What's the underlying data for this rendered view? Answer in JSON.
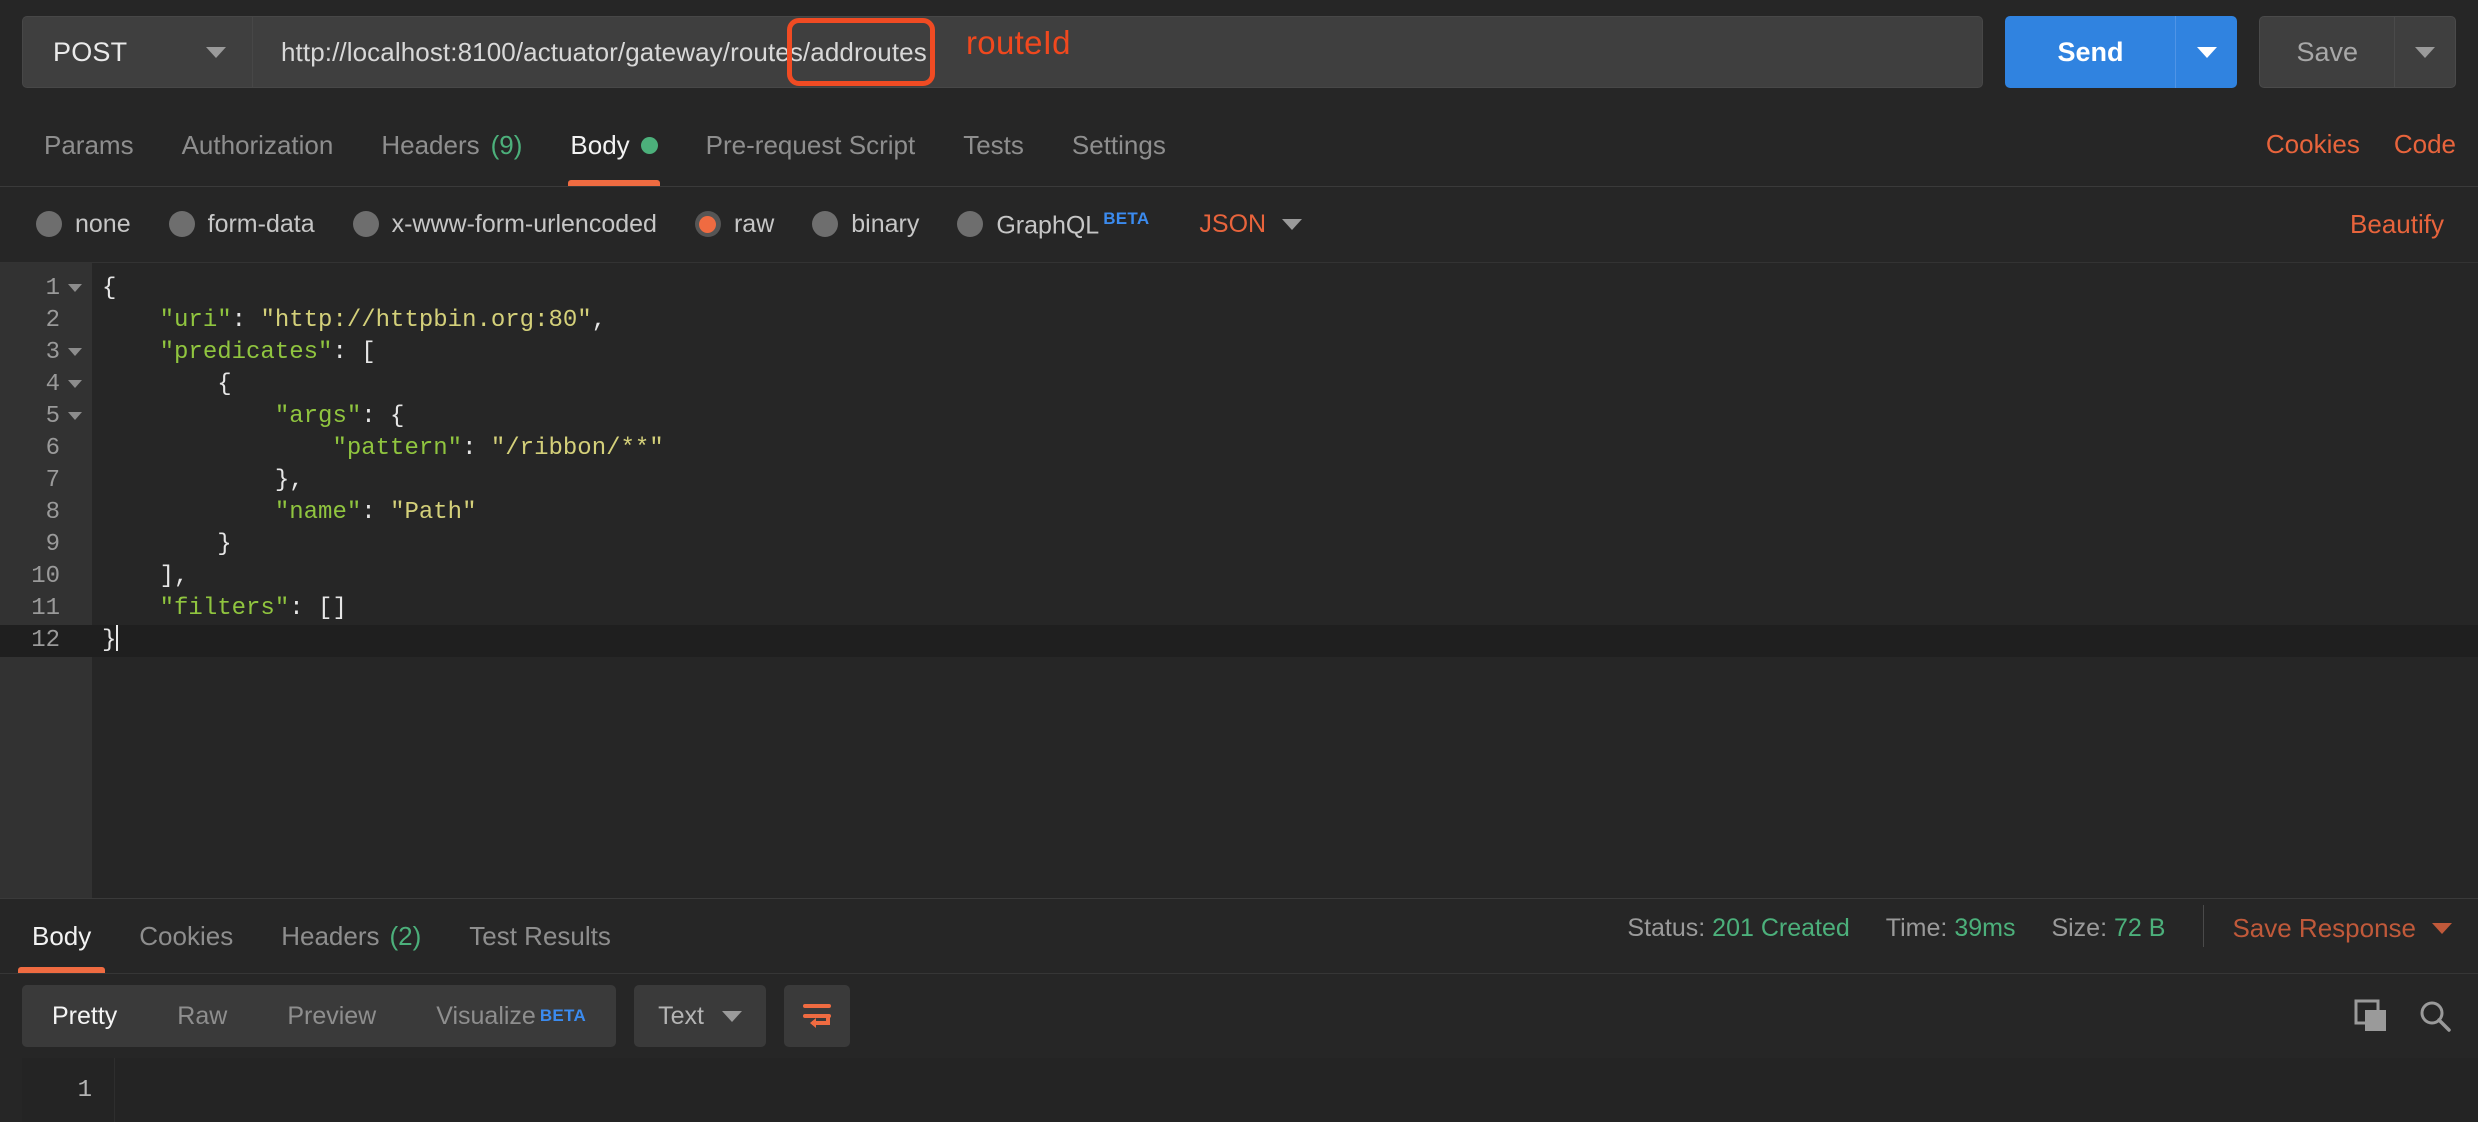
{
  "request": {
    "method": "POST",
    "url": "http://localhost:8100/actuator/gateway/routes/addroutes",
    "url_prefix": "http://localhost:8100/actuator/gateway/routes/",
    "url_highlight": "addroutes",
    "annotation_label": "routeId",
    "send_label": "Send",
    "save_label": "Save"
  },
  "request_tabs": {
    "items": [
      {
        "label": "Params",
        "count": "",
        "active": false
      },
      {
        "label": "Authorization",
        "count": "",
        "active": false
      },
      {
        "label": "Headers",
        "count": "(9)",
        "active": false
      },
      {
        "label": "Body",
        "count": "",
        "active": true
      },
      {
        "label": "Pre-request Script",
        "count": "",
        "active": false
      },
      {
        "label": "Tests",
        "count": "",
        "active": false
      },
      {
        "label": "Settings",
        "count": "",
        "active": false
      }
    ],
    "cookies_label": "Cookies",
    "code_label": "Code"
  },
  "body_type": {
    "options": [
      {
        "label": "none",
        "selected": false
      },
      {
        "label": "form-data",
        "selected": false
      },
      {
        "label": "x-www-form-urlencoded",
        "selected": false
      },
      {
        "label": "raw",
        "selected": true
      },
      {
        "label": "binary",
        "selected": false
      },
      {
        "label": "GraphQL",
        "selected": false,
        "badge": "BETA"
      }
    ],
    "format": "JSON",
    "beautify_label": "Beautify"
  },
  "editor": {
    "lines": [
      {
        "n": "1",
        "fold": true,
        "active": false,
        "tokens": [
          {
            "t": "{",
            "c": "p"
          }
        ]
      },
      {
        "n": "2",
        "fold": false,
        "active": false,
        "tokens": [
          {
            "t": "    ",
            "c": "p"
          },
          {
            "t": "\"uri\"",
            "c": "k"
          },
          {
            "t": ": ",
            "c": "p"
          },
          {
            "t": "\"http://httpbin.org:80\"",
            "c": "s"
          },
          {
            "t": ",",
            "c": "p"
          }
        ]
      },
      {
        "n": "3",
        "fold": true,
        "active": false,
        "tokens": [
          {
            "t": "    ",
            "c": "p"
          },
          {
            "t": "\"predicates\"",
            "c": "k"
          },
          {
            "t": ": [",
            "c": "p"
          }
        ]
      },
      {
        "n": "4",
        "fold": true,
        "active": false,
        "tokens": [
          {
            "t": "        {",
            "c": "p"
          }
        ]
      },
      {
        "n": "5",
        "fold": true,
        "active": false,
        "tokens": [
          {
            "t": "            ",
            "c": "p"
          },
          {
            "t": "\"args\"",
            "c": "k"
          },
          {
            "t": ": {",
            "c": "p"
          }
        ]
      },
      {
        "n": "6",
        "fold": false,
        "active": false,
        "tokens": [
          {
            "t": "                ",
            "c": "p"
          },
          {
            "t": "\"pattern\"",
            "c": "k"
          },
          {
            "t": ": ",
            "c": "p"
          },
          {
            "t": "\"/ribbon/**\"",
            "c": "s"
          }
        ]
      },
      {
        "n": "7",
        "fold": false,
        "active": false,
        "tokens": [
          {
            "t": "            },",
            "c": "p"
          }
        ]
      },
      {
        "n": "8",
        "fold": false,
        "active": false,
        "tokens": [
          {
            "t": "            ",
            "c": "p"
          },
          {
            "t": "\"name\"",
            "c": "k"
          },
          {
            "t": ": ",
            "c": "p"
          },
          {
            "t": "\"Path\"",
            "c": "s"
          }
        ]
      },
      {
        "n": "9",
        "fold": false,
        "active": false,
        "tokens": [
          {
            "t": "        }",
            "c": "p"
          }
        ]
      },
      {
        "n": "10",
        "fold": false,
        "active": false,
        "tokens": [
          {
            "t": "    ],",
            "c": "p"
          }
        ]
      },
      {
        "n": "11",
        "fold": false,
        "active": false,
        "tokens": [
          {
            "t": "    ",
            "c": "p"
          },
          {
            "t": "\"filters\"",
            "c": "k"
          },
          {
            "t": ": []",
            "c": "p"
          }
        ]
      },
      {
        "n": "12",
        "fold": false,
        "active": true,
        "tokens": [
          {
            "t": "}",
            "c": "p"
          }
        ],
        "cursor": true
      }
    ]
  },
  "response_tabs": {
    "items": [
      {
        "label": "Body",
        "count": "",
        "active": true
      },
      {
        "label": "Cookies",
        "count": "",
        "active": false
      },
      {
        "label": "Headers",
        "count": "(2)",
        "active": false
      },
      {
        "label": "Test Results",
        "count": "",
        "active": false
      }
    ]
  },
  "response_meta": {
    "status_label": "Status:",
    "status_value": "201 Created",
    "time_label": "Time:",
    "time_value": "39ms",
    "size_label": "Size:",
    "size_value": "72 B",
    "save_response_label": "Save Response"
  },
  "response_toolbar": {
    "views": [
      {
        "label": "Pretty",
        "active": true
      },
      {
        "label": "Raw",
        "active": false
      },
      {
        "label": "Preview",
        "active": false
      },
      {
        "label": "Visualize",
        "active": false,
        "badge": "BETA"
      }
    ],
    "format": "Text"
  },
  "response_body": {
    "line_number": "1",
    "content": ""
  },
  "colors": {
    "accent_orange": "#ef6b41",
    "annotation_red": "#f04b23",
    "send_blue": "#3083e0",
    "status_green": "#4cb07b",
    "json_key_green": "#90c53f",
    "json_string_yellow": "#d4d07a",
    "beta_blue": "#3b8bef"
  }
}
